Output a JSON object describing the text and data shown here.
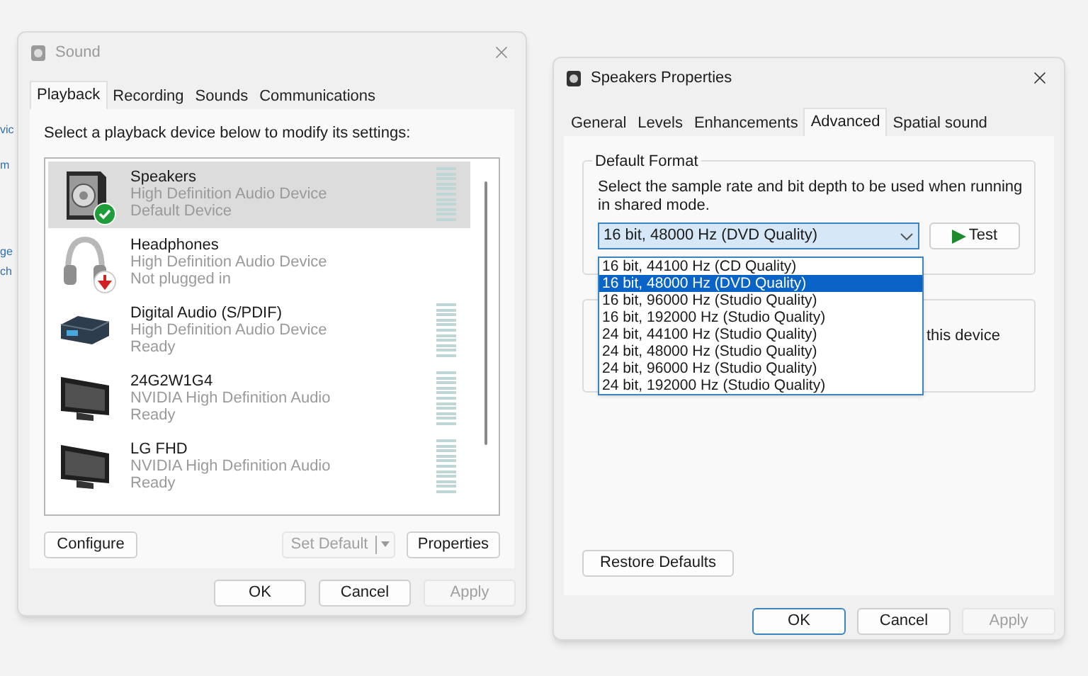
{
  "background_fragments": [
    "vic",
    "m",
    "ge",
    "ch"
  ],
  "sound_window": {
    "title": "Sound",
    "tabs": [
      {
        "label": "Playback",
        "selected": true
      },
      {
        "label": "Recording",
        "selected": false
      },
      {
        "label": "Sounds",
        "selected": false
      },
      {
        "label": "Communications",
        "selected": false
      }
    ],
    "instruction": "Select a playback device below to modify its settings:",
    "devices": [
      {
        "name": "Speakers",
        "description": "High Definition Audio Device",
        "status": "Default Device",
        "kind": "speaker",
        "is_default": true,
        "unplugged": false,
        "selected": true,
        "meter": true
      },
      {
        "name": "Headphones",
        "description": "High Definition Audio Device",
        "status": "Not plugged in",
        "kind": "headphones",
        "is_default": false,
        "unplugged": true,
        "selected": false,
        "meter": false
      },
      {
        "name": "Digital Audio (S/PDIF)",
        "description": "High Definition Audio Device",
        "status": "Ready",
        "kind": "spdif",
        "is_default": false,
        "unplugged": false,
        "selected": false,
        "meter": true
      },
      {
        "name": "24G2W1G4",
        "description": "NVIDIA High Definition Audio",
        "status": "Ready",
        "kind": "monitor",
        "is_default": false,
        "unplugged": false,
        "selected": false,
        "meter": true
      },
      {
        "name": "LG FHD",
        "description": "NVIDIA High Definition Audio",
        "status": "Ready",
        "kind": "monitor",
        "is_default": false,
        "unplugged": false,
        "selected": false,
        "meter": true
      }
    ],
    "configure_button": {
      "label": "Configure",
      "disabled": false
    },
    "set_default_button": {
      "label": "Set Default",
      "disabled": true
    },
    "properties_button": {
      "label": "Properties",
      "disabled": false
    },
    "dialog_buttons": [
      {
        "label": "OK",
        "disabled": false,
        "focused": false
      },
      {
        "label": "Cancel",
        "disabled": false,
        "focused": false
      },
      {
        "label": "Apply",
        "disabled": true,
        "focused": false
      }
    ]
  },
  "properties_window": {
    "title": "Speakers Properties",
    "tabs": [
      {
        "label": "General",
        "selected": false
      },
      {
        "label": "Levels",
        "selected": false
      },
      {
        "label": "Enhancements",
        "selected": false
      },
      {
        "label": "Advanced",
        "selected": true
      },
      {
        "label": "Spatial sound",
        "selected": false
      }
    ],
    "default_format": {
      "label": "Default Format",
      "description": "Select the sample rate and bit depth to be used when running in shared mode.",
      "value": "16 bit, 48000 Hz (DVD Quality)",
      "test_button": "Test",
      "options": [
        {
          "label": "16 bit, 44100 Hz (CD Quality)",
          "selected": false
        },
        {
          "label": "16 bit, 48000 Hz (DVD Quality)",
          "selected": true
        },
        {
          "label": "16 bit, 96000 Hz (Studio Quality)",
          "selected": false
        },
        {
          "label": "16 bit, 192000 Hz (Studio Quality)",
          "selected": false
        },
        {
          "label": "24 bit, 44100 Hz (Studio Quality)",
          "selected": false
        },
        {
          "label": "24 bit, 48000 Hz (Studio Quality)",
          "selected": false
        },
        {
          "label": "24 bit, 96000 Hz (Studio Quality)",
          "selected": false
        },
        {
          "label": "24 bit, 192000 Hz (Studio Quality)",
          "selected": false
        }
      ]
    },
    "exclusive_group": {
      "text": "this device"
    },
    "restore_button": "Restore Defaults",
    "dialog_buttons": [
      {
        "label": "OK",
        "disabled": false,
        "focused": true
      },
      {
        "label": "Cancel",
        "disabled": false,
        "focused": false
      },
      {
        "label": "Apply",
        "disabled": true,
        "focused": false
      }
    ]
  }
}
